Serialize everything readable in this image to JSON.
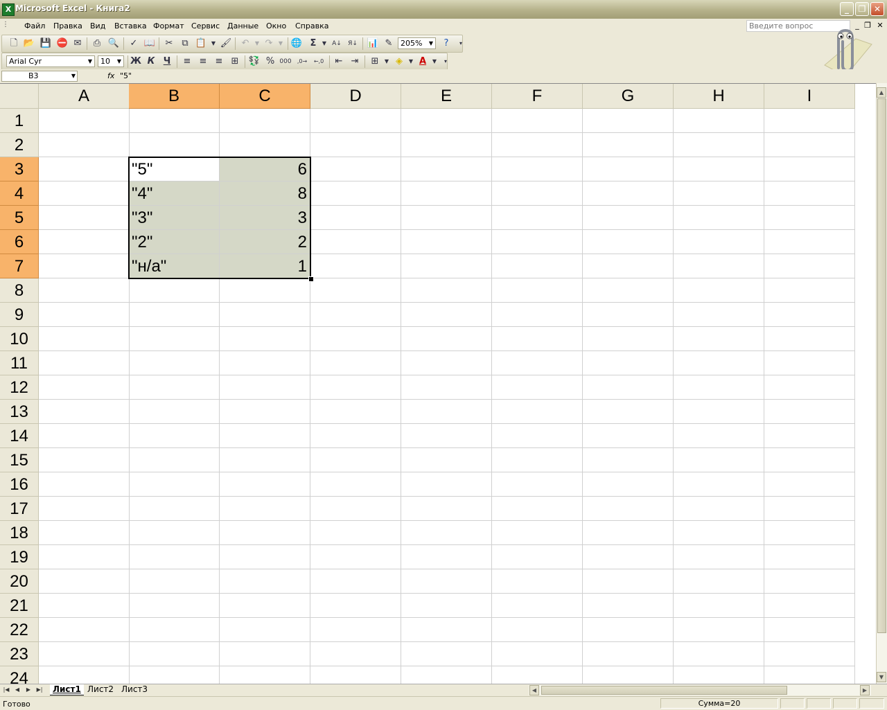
{
  "window": {
    "title": "Microsoft Excel - Книга2"
  },
  "menu": [
    {
      "label": "Файл"
    },
    {
      "label": "Правка"
    },
    {
      "label": "Вид"
    },
    {
      "label": "Вставка"
    },
    {
      "label": "Формат"
    },
    {
      "label": "Сервис"
    },
    {
      "label": "Данные"
    },
    {
      "label": "Окно"
    },
    {
      "label": "Справка"
    }
  ],
  "help_search": {
    "placeholder": "Введите вопрос"
  },
  "toolbar": {
    "zoom": "205%",
    "font_name": "Arial Cyr",
    "font_size": "10",
    "bold_label": "Ж",
    "italic_label": "К",
    "underline_label": "Ч"
  },
  "formula_bar": {
    "name_box": "B3",
    "fx_label": "fx",
    "formula": "\"5\""
  },
  "columns": [
    "A",
    "B",
    "C",
    "D",
    "E",
    "F",
    "G",
    "H",
    "I"
  ],
  "rows": [
    "1",
    "2",
    "3",
    "4",
    "5",
    "6",
    "7",
    "8",
    "9",
    "10",
    "11",
    "12",
    "13",
    "14",
    "15",
    "16",
    "17",
    "18",
    "19",
    "20",
    "21",
    "22",
    "23",
    "24"
  ],
  "cells": {
    "B3": "\"5\"",
    "C3": "6",
    "B4": "\"4\"",
    "C4": "8",
    "B5": "\"3\"",
    "C5": "3",
    "B6": "\"2\"",
    "C6": "2",
    "B7": "\"н/а\"",
    "C7": "1"
  },
  "sheets": [
    {
      "label": "Лист1",
      "active": true
    },
    {
      "label": "Лист2",
      "active": false
    },
    {
      "label": "Лист3",
      "active": false
    }
  ],
  "status": {
    "text": "Готово",
    "sum": "Сумма=20"
  },
  "colors": {
    "header_selected": "#f8b36a",
    "selection_fill": "#d5d8c7"
  }
}
